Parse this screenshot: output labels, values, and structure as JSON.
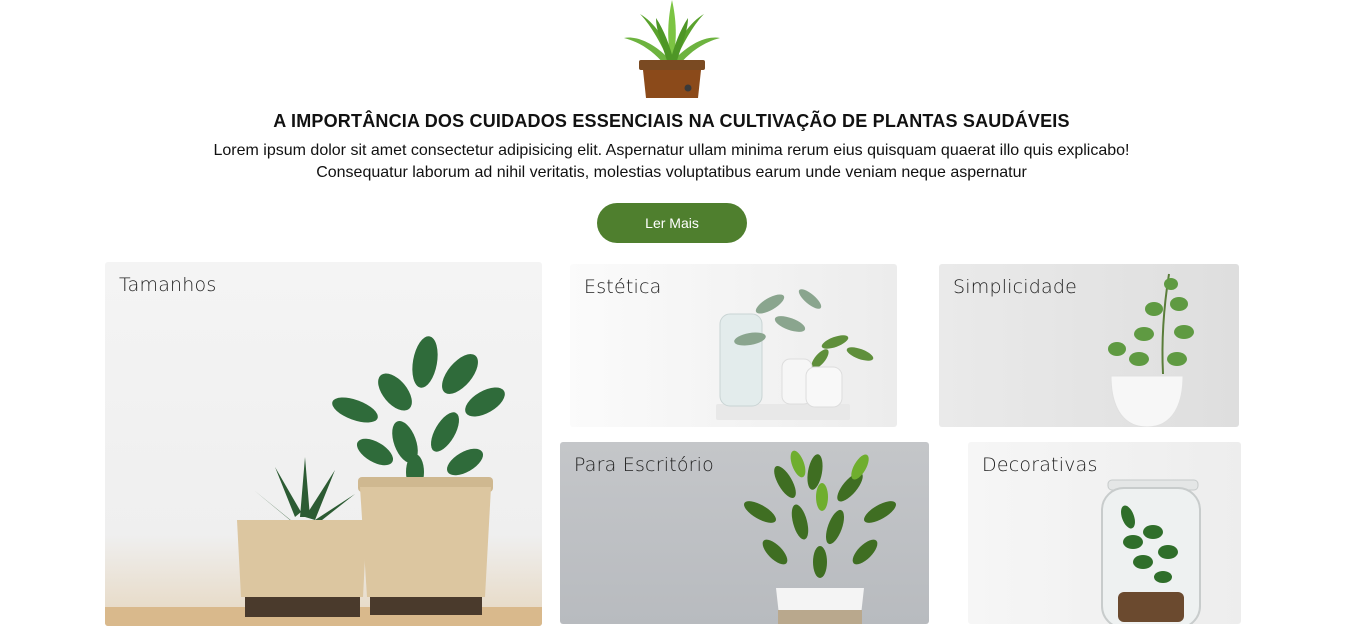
{
  "hero": {
    "logo_icon": "potted-plant-icon",
    "title": "A IMPORTÂNCIA DOS CUIDADOS ESSENCIAIS NA CULTIVAÇÃO DE PLANTAS SAUDÁVEIS",
    "description": "Lorem ipsum dolor sit amet consectetur adipisicing elit. Aspernatur ullam minima rerum eius quisquam quaerat illo quis explicabo! Consequatur laborum ad nihil veritatis, molestias voluptatibus earum unde veniam neque aspernatur",
    "cta_label": "Ler Mais",
    "accent_color": "#4f7f2e"
  },
  "cards": [
    {
      "label": "Tamanhos",
      "image": "two-succulents-in-woven-pots"
    },
    {
      "label": "Estética",
      "image": "plants-in-glass-and-white-pots"
    },
    {
      "label": "Simplicidade",
      "image": "small-plant-in-white-pot"
    },
    {
      "label": "Para Escritório",
      "image": "zz-plant-in-white-pot"
    },
    {
      "label": "Decorativas",
      "image": "plant-in-glass-terrarium"
    }
  ]
}
